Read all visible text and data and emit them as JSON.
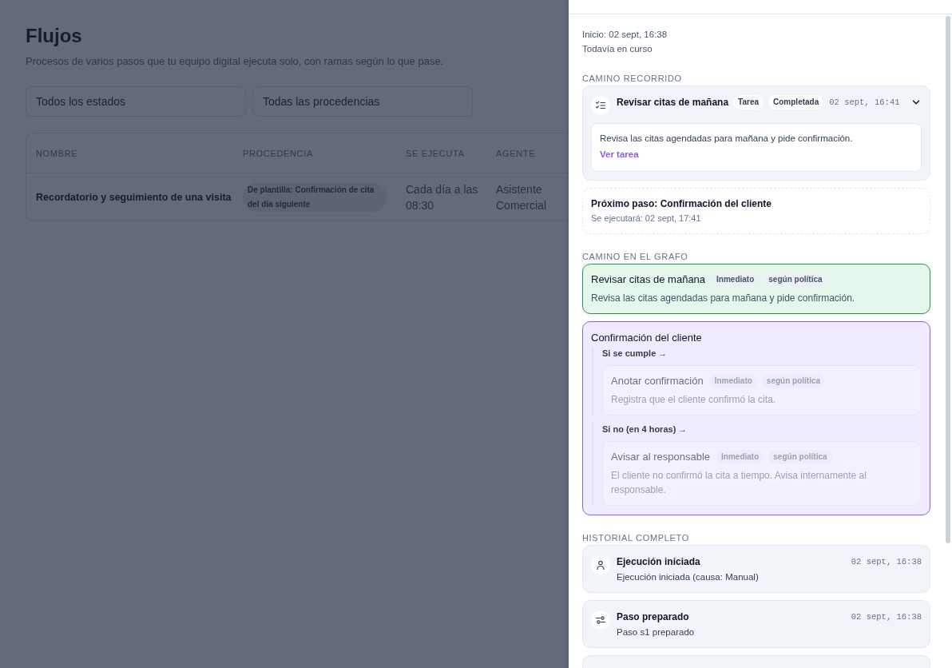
{
  "page": {
    "title": "Flujos",
    "subtitle": "Procesos de varios pasos que tu equipo digital ejecuta solo, con ramas según lo que pase.",
    "filters": [
      {
        "value": "Todos los estados"
      },
      {
        "value": "Todas las procedencias"
      }
    ],
    "table": {
      "columns": [
        "NOMBRE",
        "PROCEDENCIA",
        "SE EJECUTA",
        "AGENTE"
      ],
      "rows": [
        {
          "name": "Recordatorio y seguimiento de una visita",
          "origin": "De plantilla: Confirmación de cita del día siguiente",
          "schedule": "Cada día a las 08:30",
          "agent": "Asistente Comercial"
        }
      ]
    }
  },
  "drawer": {
    "summary": [
      "Inicio: 02 sept, 16:38",
      "Todavía en curso"
    ],
    "path": {
      "title": "CAMINO RECORRIDO",
      "steps": [
        {
          "title": "Revisar citas de mañana",
          "tags": [
            "Tarea",
            "Completada"
          ],
          "time": "02 sept, 16:41",
          "expanded": true,
          "description": "Revisa las citas agendadas para mañana y pide confirmación.",
          "link": "Ver tarea"
        }
      ],
      "next": {
        "title": "Próximo paso: Confirmación del cliente",
        "when": "Se ejecutará: 02 sept, 17:41"
      }
    },
    "graph": {
      "title": "CAMINO EN EL GRAFO",
      "nodes": [
        {
          "title": "Revisar citas de mañana",
          "done": true,
          "active": false,
          "tags": [
            "Inmediato",
            "según política"
          ],
          "description": "Revisa las citas agendadas para mañana y pide confirmación."
        },
        {
          "title": "Confirmación del cliente",
          "done": false,
          "active": true,
          "branches": [
            {
              "label": "Si se cumple →",
              "nodes": [
                {
                  "title": "Anotar confirmación",
                  "done": false,
                  "active": false,
                  "tags": [
                    "Inmediato",
                    "según política"
                  ],
                  "description": "Registra que el cliente confirmó la cita."
                }
              ]
            },
            {
              "label": "Si no (en 4 horas) →",
              "nodes": [
                {
                  "title": "Avisar al responsable",
                  "done": false,
                  "active": false,
                  "tags": [
                    "Inmediato",
                    "según política"
                  ],
                  "description": "El cliente no confirmó la cita a tiempo. Avisa internamente al responsable."
                }
              ]
            }
          ]
        }
      ]
    },
    "history": {
      "title": "HISTORIAL COMPLETO",
      "events": [
        {
          "kind": "start",
          "title": "Ejecución iniciada",
          "time": "02 sept, 16:38",
          "description": "Ejecución iniciada (causa: Manual)"
        },
        {
          "kind": "prepared",
          "title": "Paso preparado",
          "time": "02 sept, 16:38",
          "description": "Paso s1 preparado"
        },
        {
          "kind": "step"
        }
      ]
    }
  }
}
